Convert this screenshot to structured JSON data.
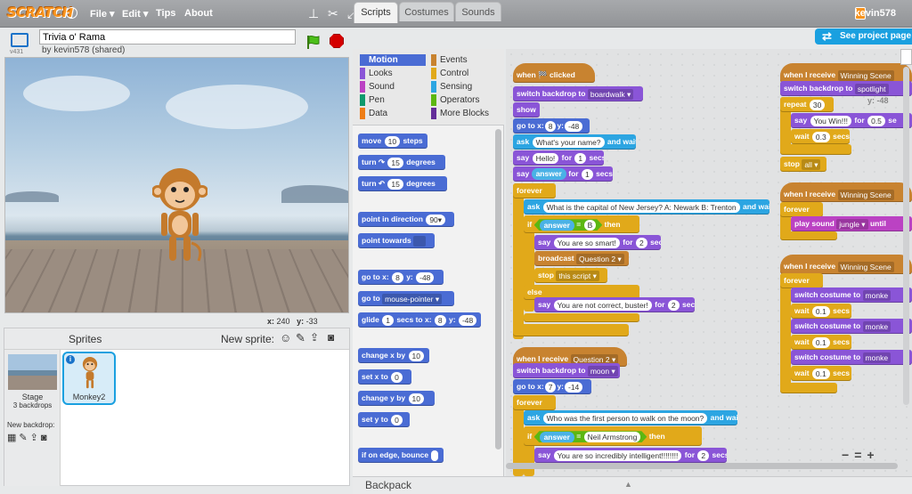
{
  "menubar": {
    "logo": "SCRATCH",
    "file": "File ▾",
    "edit": "Edit ▾",
    "tips": "Tips",
    "about": "About",
    "user": "kevin578"
  },
  "project": {
    "title": "Trivia o' Rama",
    "byline": "by kevin578 (shared)",
    "version": "v431"
  },
  "stage": {
    "x_label": "x:",
    "x": "240",
    "y_label": "y:",
    "y": "-33"
  },
  "sprites": {
    "header": "Sprites",
    "new_sprite": "New sprite:",
    "stage_label": "Stage",
    "stage_sub": "3 backdrops",
    "new_backdrop": "New backdrop:",
    "items": [
      {
        "name": "Monkey2"
      }
    ]
  },
  "tabs": [
    "Scripts",
    "Costumes",
    "Sounds"
  ],
  "see_project": "See project page",
  "categories": {
    "left": [
      {
        "label": "Motion",
        "color": "#4a6cd4"
      },
      {
        "label": "Looks",
        "color": "#8a55d7"
      },
      {
        "label": "Sound",
        "color": "#bb42c3"
      },
      {
        "label": "Pen",
        "color": "#0e9a6c"
      },
      {
        "label": "Data",
        "color": "#ee7d16"
      }
    ],
    "right": [
      {
        "label": "Events",
        "color": "#c88330"
      },
      {
        "label": "Control",
        "color": "#e1a91a"
      },
      {
        "label": "Sensing",
        "color": "#2ca5e2"
      },
      {
        "label": "Operators",
        "color": "#5cb712"
      },
      {
        "label": "More Blocks",
        "color": "#632d99"
      }
    ]
  },
  "palette_blocks": [
    {
      "label": "move",
      "f1": "10",
      "tail": "steps"
    },
    {
      "label": "turn ↷",
      "f1": "15",
      "tail": "degrees"
    },
    {
      "label": "turn ↶",
      "f1": "15",
      "tail": "degrees"
    },
    {
      "label": "point in direction",
      "f1": "90▾",
      "tail": ""
    },
    {
      "label": "point towards",
      "f1": "",
      "tail": ""
    },
    {
      "label": "go to x:",
      "f1": "8",
      "mid": "y:",
      "f2": "-48"
    },
    {
      "label": "go to",
      "f1": "mouse-pointer ▾",
      "tail": ""
    },
    {
      "label": "glide",
      "f1": "1",
      "mid": "secs to x:",
      "f2": "8",
      "mid2": "y:",
      "f3": "-48"
    },
    {
      "label": "change x by",
      "f1": "10",
      "tail": ""
    },
    {
      "label": "set x to",
      "f1": "0",
      "tail": ""
    },
    {
      "label": "change y by",
      "f1": "10",
      "tail": ""
    },
    {
      "label": "set y to",
      "f1": "0",
      "tail": ""
    },
    {
      "label": "if on edge, bounce",
      "f1": "",
      "tail": ""
    }
  ],
  "script1": {
    "hat": "when 🏁 clicked",
    "b1": "switch backdrop to",
    "b1v": "boardwalk ▾",
    "b2": "show",
    "b3": "go to x:",
    "b3a": "8",
    "b3b": "y:",
    "b3c": "-48",
    "b4": "ask",
    "b4v": "What's your name?",
    "b4t": "and wait",
    "b5": "say",
    "b5v": "Hello!",
    "b5m": "for",
    "b5n": "1",
    "b5t": "secs",
    "b6": "say",
    "b6v": "answer",
    "b6m": "for",
    "b6n": "1",
    "b6t": "secs",
    "forever": "forever",
    "b7": "ask",
    "b7v": "What is the capital of New Jersey?  A: Newark   B: Trenton",
    "b7t": "and wait",
    "if": "if",
    "ifa": "answer",
    "ifeq": "=",
    "ifv": "B",
    "then": "then",
    "b8": "say",
    "b8v": "You are so smart!",
    "b8m": "for",
    "b8n": "2",
    "b8t": "secs",
    "b9": "broadcast",
    "b9v": "Question 2 ▾",
    "b10": "stop",
    "b10v": "this script ▾",
    "else": "else",
    "b11": "say",
    "b11v": "You are not correct, buster!",
    "b11m": "for",
    "b11n": "2",
    "b11t": "secs"
  },
  "script2": {
    "hat": "when I receive",
    "hatv": "Question 2 ▾",
    "b1": "switch backdrop to",
    "b1v": "moon ▾",
    "b2": "go to x:",
    "b2a": "7",
    "b2b": "y:",
    "b2c": "-14",
    "forever": "forever",
    "b3": "ask",
    "b3v": "Who was the first person to walk on the moon?",
    "b3t": "and wait",
    "if": "if",
    "ifa": "answer",
    "ifeq": "=",
    "ifv": "Neil Armstrong",
    "then": "then",
    "b4": "say",
    "b4v": "You are so incredibly intelligent!!!!!!!!",
    "b4m": "for",
    "b4n": "2",
    "b4t": "secs"
  },
  "script3": {
    "hat": "when I receive",
    "hatv": "Winning Scene",
    "b1": "switch backdrop to",
    "b1v": "spotlight",
    "b1y": "y:",
    "b1yv": "-48",
    "repeat": "repeat",
    "repv": "30",
    "b2": "say",
    "b2v": "You Win!!!",
    "b2m": "for",
    "b2n": "0.5",
    "b2t": "se",
    "b3": "wait",
    "b3v": "0.3",
    "b3t": "secs",
    "stop": "stop",
    "stopv": "all ▾"
  },
  "script4": {
    "hat": "when I receive",
    "hatv": "Winning Scene",
    "forever": "forever",
    "b1": "play sound",
    "b1v": "jungle ▾",
    "b1t": "until"
  },
  "script5": {
    "hat": "when I receive",
    "hatv": "Winning Scene",
    "forever": "forever",
    "sw": "switch costume to",
    "swv": "monke",
    "wait": "wait",
    "waitv": "0.1",
    "secs": "secs"
  },
  "zoom": {
    "out": "−",
    "reset": "=",
    "in": "+"
  },
  "backpack": "Backpack"
}
